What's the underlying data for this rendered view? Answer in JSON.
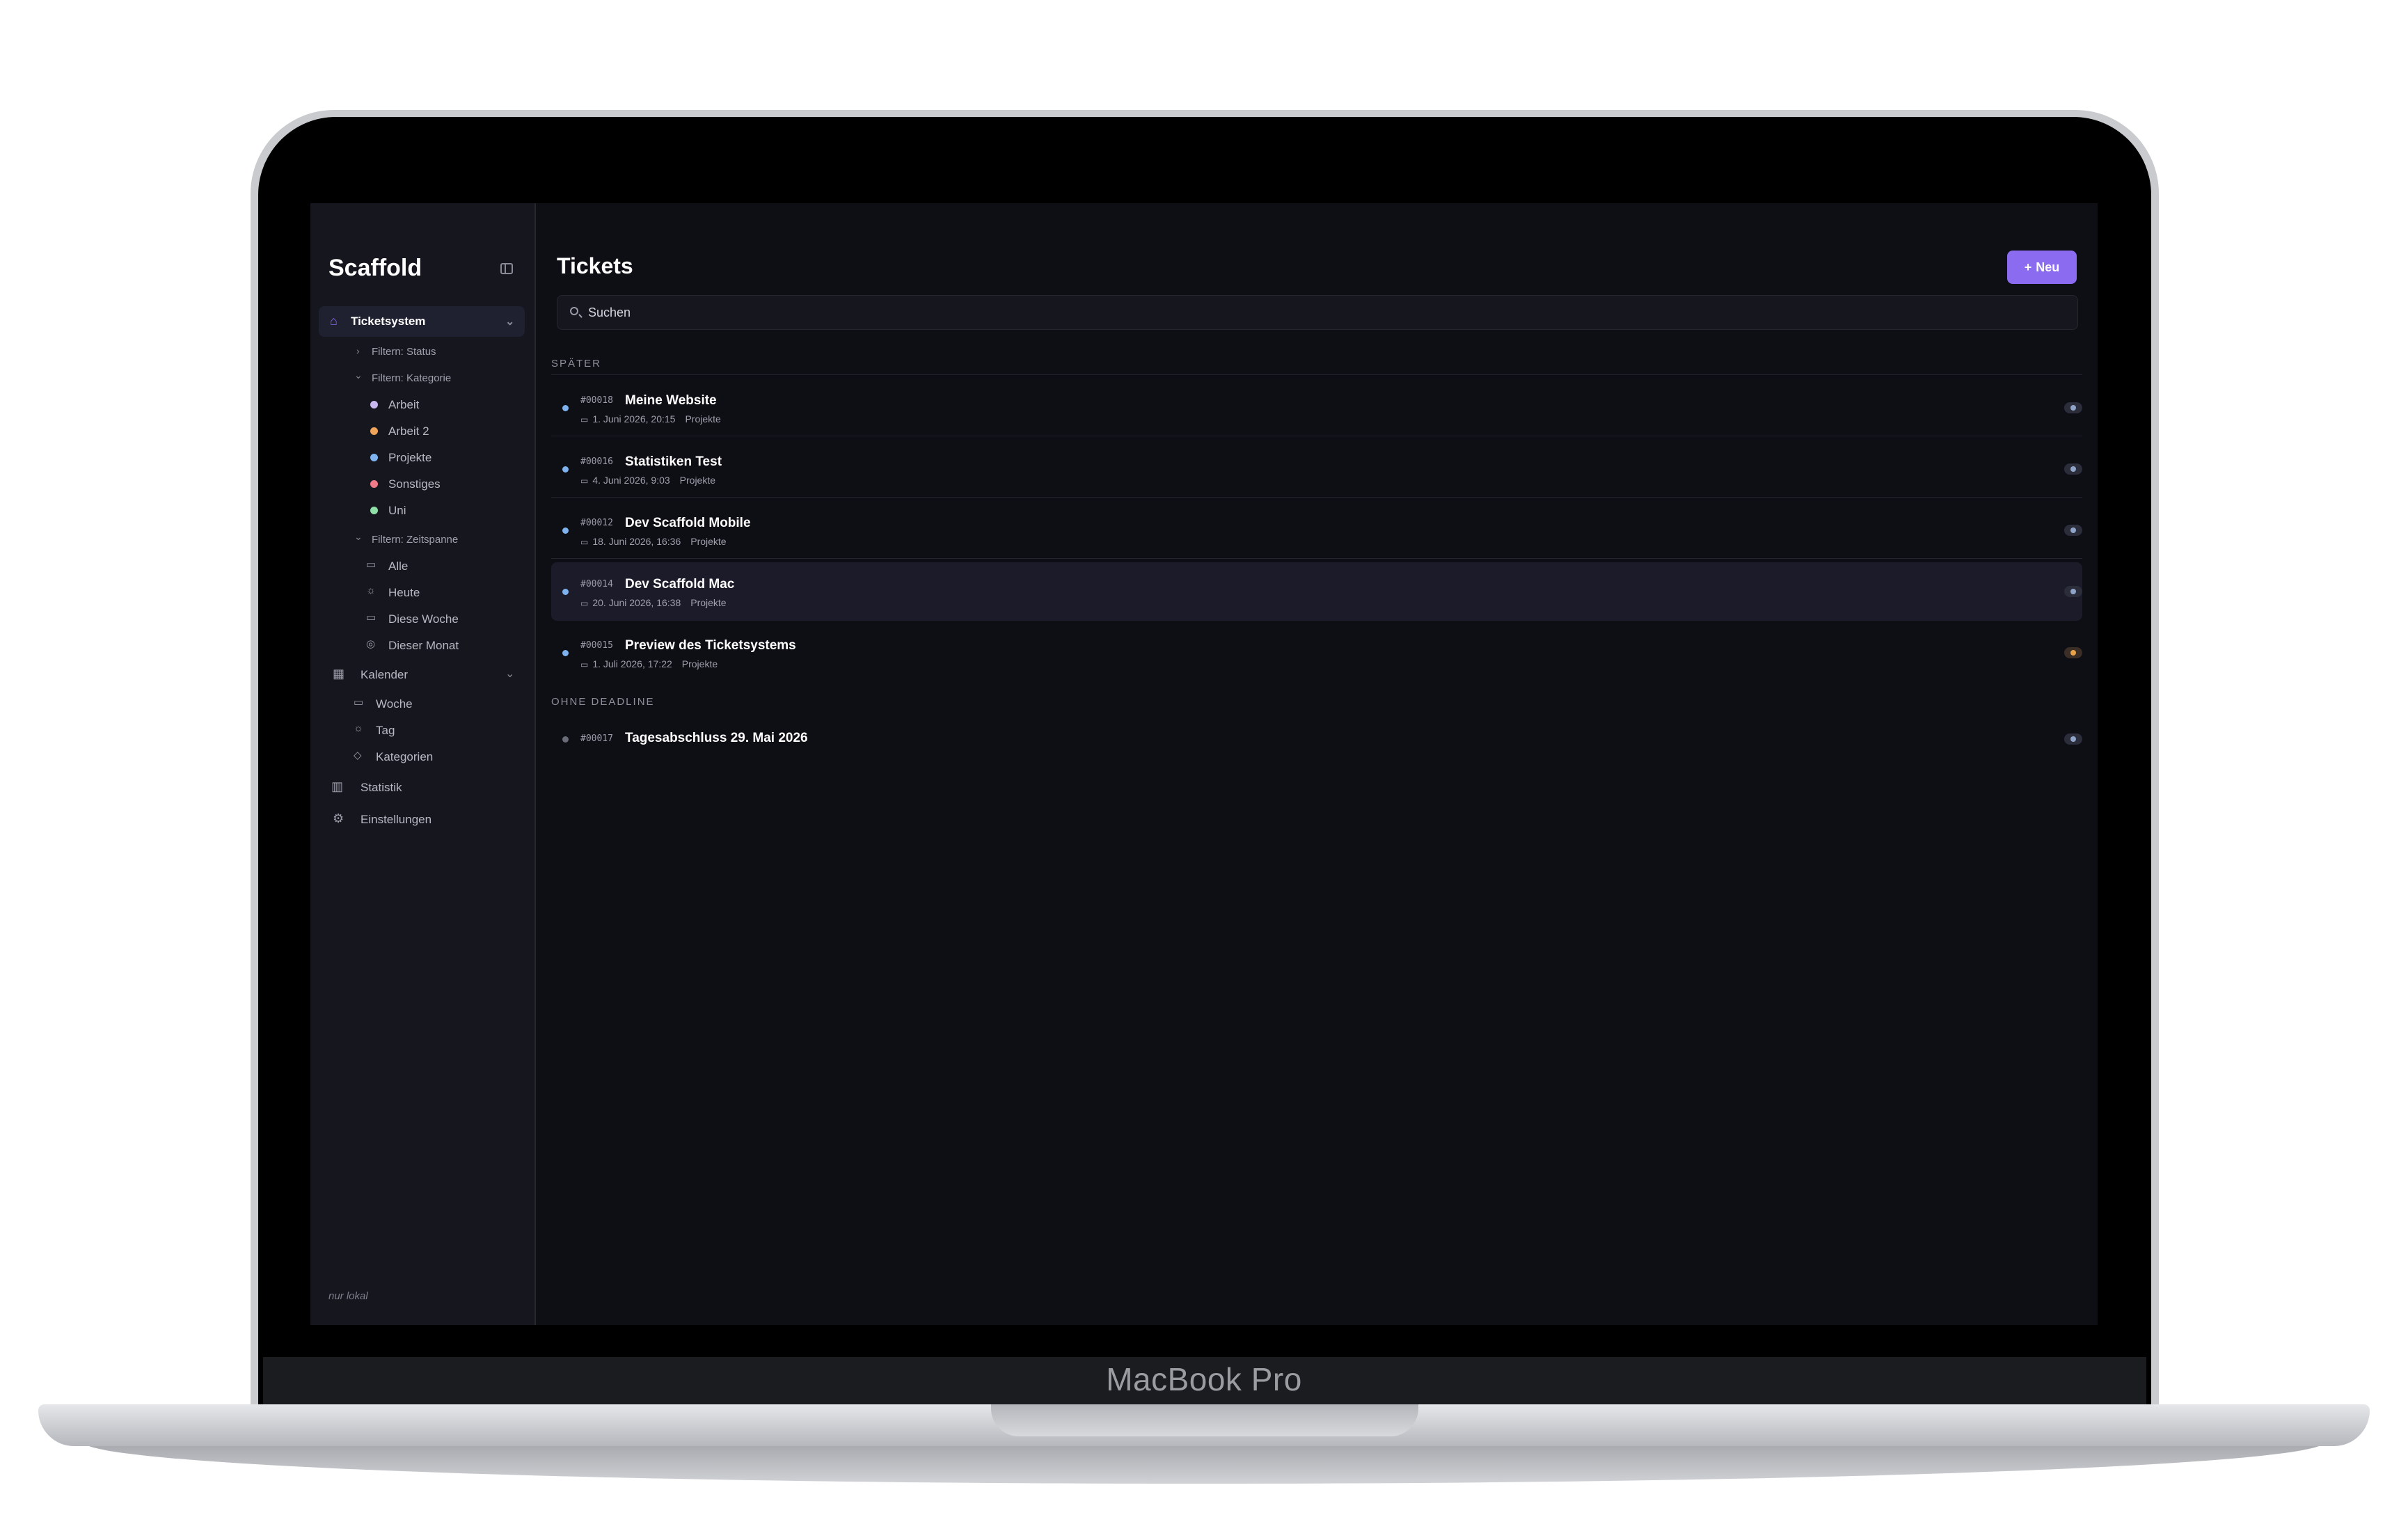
{
  "device": {
    "brand": "MacBook Pro"
  },
  "sidebar": {
    "app_title": "Scaffold",
    "ticketsystem": {
      "label": "Ticketsystem"
    },
    "filter_status": "Filtern: Status",
    "filter_kategorie": "Filtern: Kategorie",
    "categories": [
      {
        "label": "Arbeit",
        "color": "#c9b8f0"
      },
      {
        "label": "Arbeit 2",
        "color": "#f0a35a"
      },
      {
        "label": "Projekte",
        "color": "#7fb3f0"
      },
      {
        "label": "Sonstiges",
        "color": "#f07a8a"
      },
      {
        "label": "Uni",
        "color": "#8fe0a8"
      }
    ],
    "filter_zeitspanne": "Filtern: Zeitspanne",
    "zeitspanne": [
      {
        "label": "Alle",
        "icon": "calendar-icon"
      },
      {
        "label": "Heute",
        "icon": "sun-icon"
      },
      {
        "label": "Diese Woche",
        "icon": "calendar-week-icon"
      },
      {
        "label": "Dieser Monat",
        "icon": "month-icon"
      }
    ],
    "kalender": {
      "label": "Kalender"
    },
    "kalender_items": [
      {
        "label": "Woche",
        "icon": "calendar-icon"
      },
      {
        "label": "Tag",
        "icon": "sun-icon"
      },
      {
        "label": "Kategorien",
        "icon": "tag-icon"
      }
    ],
    "statistik": "Statistik",
    "einstellungen": "Einstellungen",
    "footer_note": "nur lokal"
  },
  "main": {
    "title": "Tickets",
    "new_button": {
      "icon": "+",
      "label": "Neu"
    },
    "search": {
      "value": "Suchen"
    },
    "sections": [
      {
        "label": "SPÄTER",
        "tickets": [
          {
            "num": "#00018",
            "title": "Meine Website",
            "date": "1. Juni 2026, 20:15",
            "category": "Projekte",
            "dot": "#7fb3f0",
            "status_color": "blue"
          },
          {
            "num": "#00016",
            "title": "Statistiken Test",
            "date": "4. Juni 2026, 9:03",
            "category": "Projekte",
            "dot": "#7fb3f0",
            "status_color": "blue"
          },
          {
            "num": "#00012",
            "title": "Dev Scaffold Mobile",
            "date": "18. Juni 2026, 16:36",
            "category": "Projekte",
            "dot": "#7fb3f0",
            "status_color": "blue"
          },
          {
            "num": "#00014",
            "title": "Dev Scaffold Mac",
            "date": "20. Juni 2026, 16:38",
            "category": "Projekte",
            "dot": "#7fb3f0",
            "status_color": "blue",
            "selected": true
          },
          {
            "num": "#00015",
            "title": "Preview des Ticketsystems",
            "date": "1. Juli 2026, 17:22",
            "category": "Projekte",
            "dot": "#7fb3f0",
            "status_color": "orange"
          }
        ]
      },
      {
        "label": "OHNE DEADLINE",
        "tickets": [
          {
            "num": "#00017",
            "title": "Tagesabschluss 29. Mai 2026",
            "dot": "#6a6b78",
            "status_color": "blue"
          }
        ]
      }
    ]
  }
}
